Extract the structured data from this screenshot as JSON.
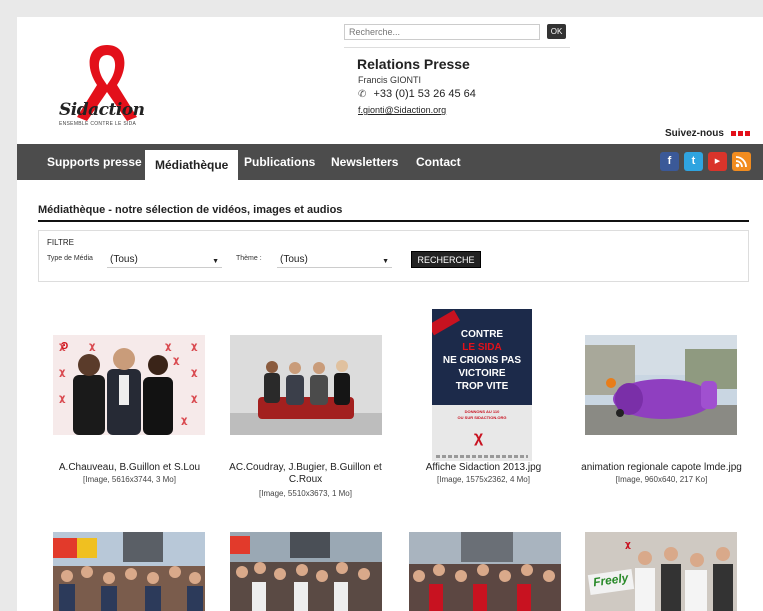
{
  "header": {
    "logo_text": "Sidaction",
    "logo_subtitle": "ENSEMBLE CONTRE LE SIDA",
    "search_placeholder": "Recherche...",
    "search_button": "OK",
    "press": {
      "title": "Relations Presse",
      "name": "Francis GIONTI",
      "phone": "+33 (0)1 53 26 45 64",
      "email": "f.gionti@Sidaction.org"
    },
    "follow_label": "Suivez-nous"
  },
  "nav": {
    "items": [
      {
        "label": "Supports presse"
      },
      {
        "label": "Médiathèque"
      },
      {
        "label": "Publications"
      },
      {
        "label": "Newsletters"
      },
      {
        "label": "Contact"
      }
    ],
    "social": [
      "facebook-icon",
      "twitter-icon",
      "youtube-icon",
      "rss-icon"
    ]
  },
  "main": {
    "title": "Médiathèque - notre sélection de vidéos, images et audios",
    "filter": {
      "label": "FILTRE",
      "type_label": "Type de Média",
      "type_value": "(Tous)",
      "theme_label": "Thème :",
      "theme_value": "(Tous)",
      "button": "RECHERCHE"
    },
    "media": [
      {
        "caption": "A.Chauveau, B.Guillon et S.Lou",
        "meta": "[Image, 5616x3744, 3 Mo]"
      },
      {
        "caption": "AC.Coudray, J.Bugier, B.Guillon et C.Roux",
        "meta": "[Image, 5510x3673, 1 Mo]"
      },
      {
        "caption": "Affiche Sidaction 2013.jpg",
        "meta": "[Image, 1575x2362, 4 Mo]"
      },
      {
        "caption": "animation regionale capote lmde.jpg",
        "meta": "[Image, 960x640, 217 Ko]"
      }
    ],
    "poster": {
      "line1": "CONTRE",
      "line2": "LE SIDA",
      "line3": "NE CRIONS PAS",
      "line4": "VICTOIRE",
      "line5": "TROP VITE",
      "small1": "DONNONS AU 110",
      "small2": "OU SUR SIDACTION.ORG"
    },
    "sign_text": "Freely"
  },
  "colors": {
    "accent_red": "#e3101a",
    "nav_bg": "#4c4c4c",
    "poster_navy": "#1c2a4a"
  }
}
